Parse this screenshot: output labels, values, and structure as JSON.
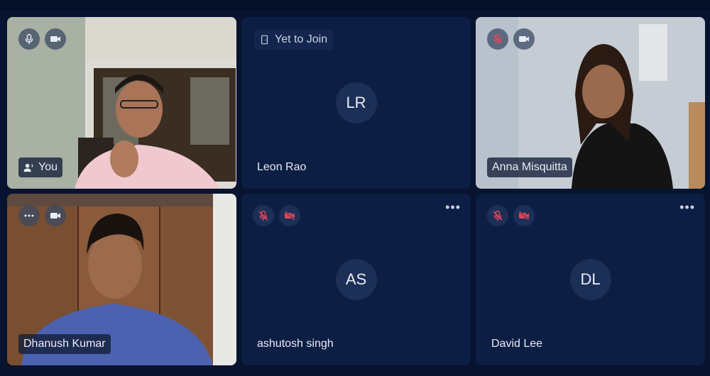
{
  "tiles": [
    {
      "name": "You",
      "type": "video"
    },
    {
      "name": "Leon Rao",
      "type": "avatar",
      "initials": "LR",
      "status": "Yet to Join"
    },
    {
      "name": "Anna Misquitta",
      "type": "video"
    },
    {
      "name": "Dhanush Kumar",
      "type": "video"
    },
    {
      "name": "ashutosh singh",
      "type": "avatar",
      "initials": "AS"
    },
    {
      "name": "David Lee",
      "type": "avatar",
      "initials": "DL"
    }
  ],
  "colors": {
    "background": "#07132f",
    "tile": "#0c1e43",
    "muted_red": "#e0455a",
    "text": "#e8ecf4"
  },
  "icons": {
    "mic": "mic-icon",
    "mic_off": "mic-off-icon",
    "camera": "camera-icon",
    "camera_off": "camera-off-icon",
    "more": "more-horizontal-icon",
    "speaker": "speaking-icon",
    "door": "door-icon"
  }
}
